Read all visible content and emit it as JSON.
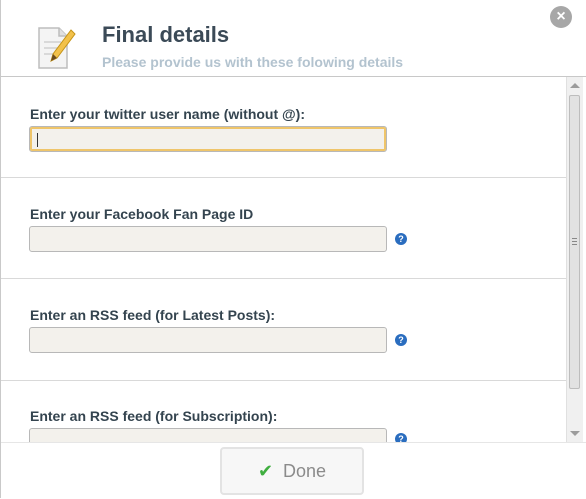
{
  "dialog": {
    "title": "Final details",
    "subtitle": "Please provide us with these folowing details",
    "close_icon": "×"
  },
  "fields": [
    {
      "label": "Enter your twitter user name (without @):",
      "value": "",
      "has_help": false,
      "focused": true
    },
    {
      "label": "Enter your Facebook Fan Page ID",
      "value": "",
      "has_help": true
    },
    {
      "label": "Enter an RSS feed (for Latest Posts):",
      "value": "",
      "has_help": true
    },
    {
      "label": "Enter an RSS feed (for Subscription):",
      "value": "",
      "has_help": true
    }
  ],
  "help_icon": "?",
  "footer": {
    "done_label": "Done",
    "done_icon": "✔"
  },
  "colors": {
    "focus_border": "#efc56a",
    "help_icon": "#2a6dbf",
    "check": "#3fae3f"
  }
}
